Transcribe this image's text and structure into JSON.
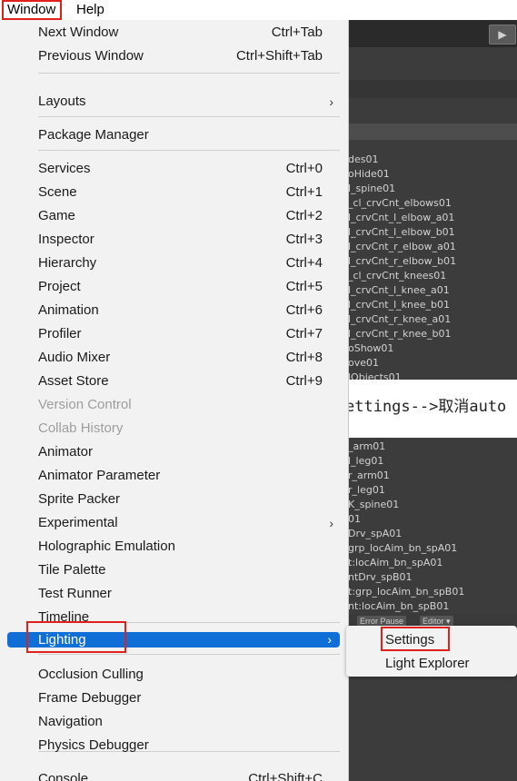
{
  "menubar": {
    "window": "Window",
    "help": "Help"
  },
  "editor": {
    "play_icon": "play-icon",
    "hierarchy_top": [
      "des01",
      "oHide01",
      "l_spine01",
      "_cl_crvCnt_elbows01",
      "l_crvCnt_l_elbow_a01",
      "l_crvCnt_l_elbow_b01",
      "l_crvCnt_r_elbow_a01",
      "l_crvCnt_r_elbow_b01",
      "_cl_crvCnt_knees01",
      "l_crvCnt_l_knee_a01",
      "l_crvCnt_l_knee_b01",
      "l_crvCnt_r_knee_a01",
      "l_crvCnt_r_knee_b01",
      "oShow01",
      "ove01",
      "lObjects01"
    ],
    "hierarchy_bottom": [
      "_arm01",
      "l_leg01",
      "r_arm01",
      "r_leg01",
      "K_spine01",
      "01",
      "Drv_spA01",
      "grp_locAim_bn_spA01",
      "t:locAim_bn_spA01",
      "ntDrv_spB01",
      "t:grp_locAim_bn_spB01",
      "nt:locAim_bn_spB01"
    ],
    "banner": "ettings-->取消auto",
    "error_pause": "Error Pause",
    "editor_dropdown": "Editor ▾"
  },
  "menu": {
    "items": [
      {
        "label": "Next Window",
        "shortcut": "Ctrl+Tab"
      },
      {
        "label": "Previous Window",
        "shortcut": "Ctrl+Shift+Tab"
      },
      {
        "label": "Layouts",
        "shortcut": "",
        "submenu": true
      },
      {
        "label": "Package Manager",
        "shortcut": ""
      },
      {
        "label": "Services",
        "shortcut": "Ctrl+0"
      },
      {
        "label": "Scene",
        "shortcut": "Ctrl+1"
      },
      {
        "label": "Game",
        "shortcut": "Ctrl+2"
      },
      {
        "label": "Inspector",
        "shortcut": "Ctrl+3"
      },
      {
        "label": "Hierarchy",
        "shortcut": "Ctrl+4"
      },
      {
        "label": "Project",
        "shortcut": "Ctrl+5"
      },
      {
        "label": "Animation",
        "shortcut": "Ctrl+6"
      },
      {
        "label": "Profiler",
        "shortcut": "Ctrl+7"
      },
      {
        "label": "Audio Mixer",
        "shortcut": "Ctrl+8"
      },
      {
        "label": "Asset Store",
        "shortcut": "Ctrl+9"
      },
      {
        "label": "Version Control",
        "shortcut": "",
        "disabled": true
      },
      {
        "label": "Collab History",
        "shortcut": "",
        "disabled": true
      },
      {
        "label": "Animator",
        "shortcut": ""
      },
      {
        "label": "Animator Parameter",
        "shortcut": ""
      },
      {
        "label": "Sprite Packer",
        "shortcut": ""
      },
      {
        "label": "Experimental",
        "shortcut": "",
        "submenu": true
      },
      {
        "label": "Holographic Emulation",
        "shortcut": ""
      },
      {
        "label": "Tile Palette",
        "shortcut": ""
      },
      {
        "label": "Test Runner",
        "shortcut": ""
      },
      {
        "label": "Timeline",
        "shortcut": ""
      },
      {
        "label": "Lighting",
        "shortcut": "",
        "submenu": true,
        "highlighted": true
      },
      {
        "label": "Occlusion Culling",
        "shortcut": ""
      },
      {
        "label": "Frame Debugger",
        "shortcut": ""
      },
      {
        "label": "Navigation",
        "shortcut": ""
      },
      {
        "label": "Physics Debugger",
        "shortcut": ""
      },
      {
        "label": "Console",
        "shortcut": "Ctrl+Shift+C"
      }
    ],
    "submenu_arrow": "chevron-right-icon"
  },
  "lighting_submenu": {
    "settings": "Settings",
    "light_explorer": "Light Explorer"
  },
  "colors": {
    "highlight": "#0f6fd6",
    "annotation_red": "#e0201a",
    "menu_bg": "#f2f2f2"
  }
}
